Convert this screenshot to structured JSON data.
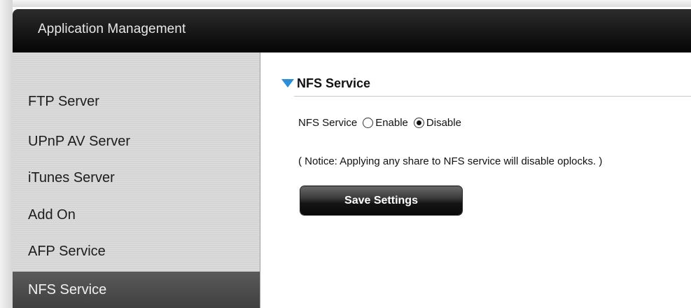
{
  "header": {
    "title": "Application Management"
  },
  "sidebar": {
    "items": [
      {
        "label": "FTP Server",
        "active": false
      },
      {
        "label": "UPnP AV Server",
        "active": false
      },
      {
        "label": "iTunes Server",
        "active": false
      },
      {
        "label": "Add On",
        "active": false
      },
      {
        "label": "AFP Service",
        "active": false
      },
      {
        "label": "NFS Service",
        "active": true
      }
    ]
  },
  "section": {
    "title": "NFS Service",
    "field_label": "NFS Service",
    "options": [
      {
        "label": "Enable",
        "selected": false
      },
      {
        "label": "Disable",
        "selected": true
      }
    ],
    "notice": "( Notice: Applying any share to NFS service will disable oplocks. )",
    "save_label": "Save Settings"
  },
  "colors": {
    "accent": "#2a8fd8",
    "header_bg": "#111111",
    "active_nav": "#4a4a4a"
  }
}
